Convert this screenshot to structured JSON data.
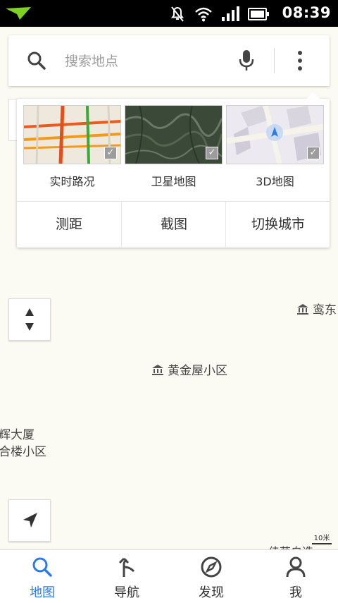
{
  "status_bar": {
    "time": "08:39"
  },
  "search": {
    "placeholder": "搜索地点"
  },
  "layers": [
    {
      "label": "实时路况",
      "checked": true
    },
    {
      "label": "卫星地图",
      "checked": true
    },
    {
      "label": "3D地图",
      "checked": true
    }
  ],
  "tools": [
    {
      "label": "测距"
    },
    {
      "label": "截图"
    },
    {
      "label": "切换城市"
    }
  ],
  "map_labels": {
    "poi_1": "黄金屋小区",
    "poi_2": "鸾东",
    "poi_3": "辉大厦",
    "poi_4": "合楼小区",
    "poi_5": "佳茵自选"
  },
  "scale": {
    "label": "10米"
  },
  "bottom_nav": [
    {
      "label": "地图",
      "active": true
    },
    {
      "label": "导航",
      "active": false
    },
    {
      "label": "发现",
      "active": false
    },
    {
      "label": "我",
      "active": false
    }
  ],
  "colors": {
    "accent": "#2c7be5",
    "map_bg": "#fcfbf3"
  }
}
